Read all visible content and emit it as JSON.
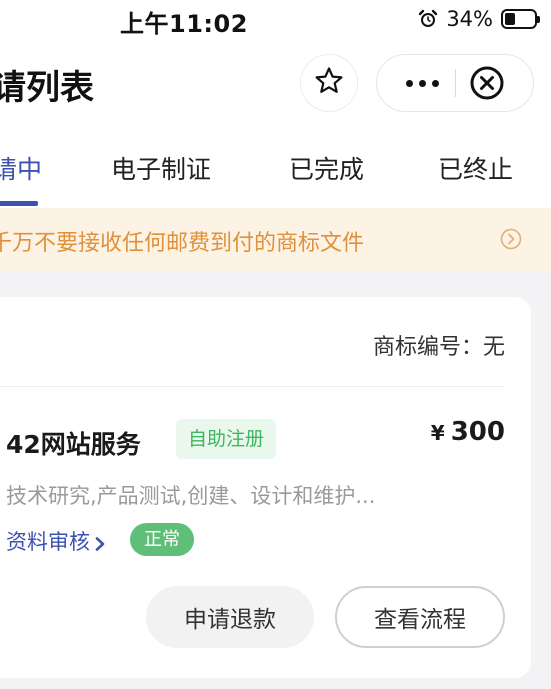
{
  "status_bar": {
    "time": "上午11:02",
    "battery_percent": "34%",
    "battery_level": 0.34,
    "alarm_icon": "alarm-clock-icon"
  },
  "nav": {
    "title": "请列表",
    "favorite_icon": "star-icon",
    "more_icon": "more-dots-icon",
    "close_icon": "close-circle-icon"
  },
  "tabs": [
    {
      "label": "请中",
      "active": true
    },
    {
      "label": "电子制证",
      "active": false
    },
    {
      "label": "已完成",
      "active": false
    },
    {
      "label": "已终止",
      "active": false
    }
  ],
  "notice": {
    "text": "千万不要接收任何邮费到付的商标文件",
    "icon": "chevron-right-circle-icon"
  },
  "order": {
    "trademark_no": "商标编号：无",
    "service_name": "42网站服务",
    "service_tag": "自助注册",
    "price_symbol": "¥",
    "price": "300",
    "description": "技术研究,产品测试,创建、设计和维护...",
    "progress_link": "资料审核",
    "status_badge": "正常",
    "refund_button": "申请退款",
    "flow_button": "查看流程"
  },
  "colors": {
    "accent": "#3d52b0",
    "notice_text": "#e0913b",
    "notice_bg": "#fdf3e5",
    "tag_green": "#3fb65f",
    "badge_green": "#5fbf78"
  }
}
